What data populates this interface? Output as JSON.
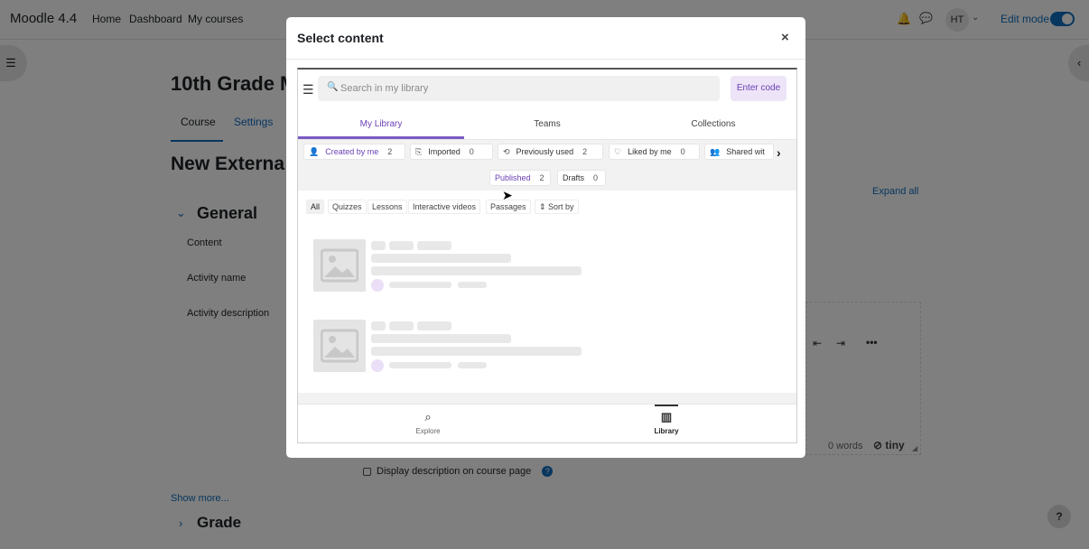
{
  "app": {
    "brand": "Moodle 4.4",
    "nav": [
      "Home",
      "Dashboard",
      "My courses"
    ],
    "user_initials": "HT",
    "edit_mode_label": "Edit mode"
  },
  "course": {
    "title": "10th Grade M",
    "tabs": [
      "Course",
      "Settings"
    ],
    "heading": "New Externa",
    "section_title": "General",
    "labels": [
      "Content",
      "Activity name",
      "Activity description"
    ],
    "expand_all": "Expand all",
    "word_count": "0 words",
    "tiny_logo": "tiny",
    "display_description": "Display description on course page",
    "show_more": "Show more...",
    "grade_title": "Grade",
    "help_fab": "?"
  },
  "modal": {
    "title": "Select content",
    "close_label": "×",
    "search_placeholder": "Search in my library",
    "enter_code": "Enter code",
    "tabs": [
      "My Library",
      "Teams",
      "Collections"
    ],
    "active_tab": "My Library",
    "filters": [
      {
        "label": "Created by me",
        "count": "2",
        "icon": "user-icon",
        "glyph": "👤"
      },
      {
        "label": "Imported",
        "count": "0",
        "icon": "import-icon",
        "glyph": "⎘"
      },
      {
        "label": "Previously used",
        "count": "2",
        "icon": "history-icon",
        "glyph": "⟲"
      },
      {
        "label": "Liked by me",
        "count": "0",
        "icon": "heart-icon",
        "glyph": "♡"
      },
      {
        "label": "Shared wit",
        "count": "",
        "icon": "group-icon",
        "glyph": "👥"
      }
    ],
    "status_filters": [
      {
        "label": "Published",
        "count": "2"
      },
      {
        "label": "Drafts",
        "count": "0"
      }
    ],
    "type_filters": [
      "All",
      "Quizzes",
      "Lessons",
      "Interactive videos",
      "Passages",
      "⇕ Sort by"
    ],
    "bottom_nav": [
      {
        "label": "Explore",
        "icon": "search-icon",
        "glyph": "⌕"
      },
      {
        "label": "Library",
        "icon": "library-icon",
        "glyph": "▥"
      }
    ]
  },
  "colors": {
    "accent": "#0f6cbf",
    "library_purple": "#7b5bc4"
  }
}
